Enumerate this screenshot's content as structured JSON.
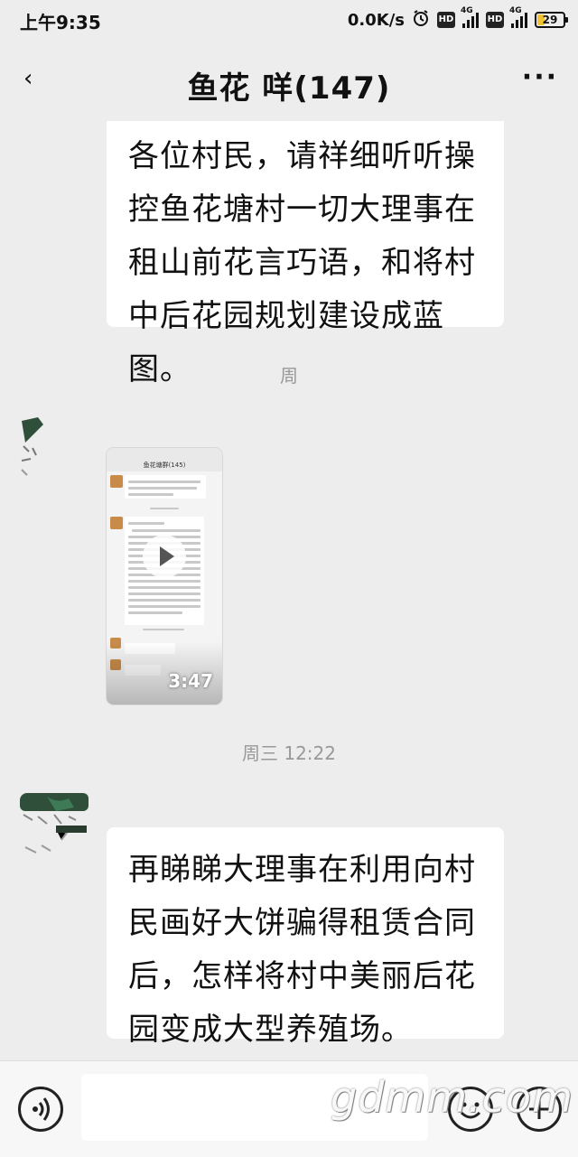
{
  "status_bar": {
    "time": "上午9:35",
    "net_speed": "0.0K/s",
    "hd_label": "HD",
    "network_label": "4G",
    "battery": "29"
  },
  "nav": {
    "back_icon": "‹",
    "title": "鱼花  咩(147)",
    "more_icon": "···"
  },
  "messages": [
    {
      "text": "各位村民，请祥细听听操\n控鱼花塘村一切大理事在\n租山前花言巧语，和将村\n中后花园规划建设成蓝图。"
    },
    {
      "timestamp": "周"
    },
    {
      "video": {
        "duration": "3:47"
      }
    },
    {
      "timestamp": "周三 12:22"
    },
    {
      "text": "再睇睇大理事在利用向村\n民画好大饼骗得租赁合同\n后，怎样将村中美丽后花\n园变成大型养殖场。"
    }
  ],
  "input_bar": {
    "voice_icon": "voice-icon",
    "emoji_icon": "emoji-icon",
    "add_icon": "+"
  },
  "watermark": "gdmm.com"
}
